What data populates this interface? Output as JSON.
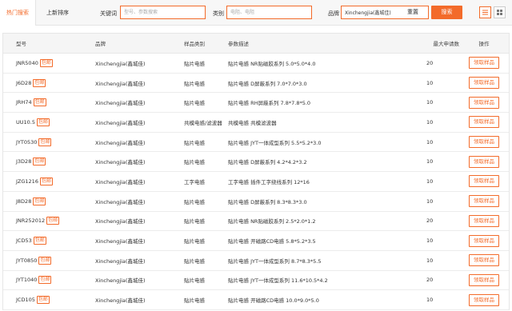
{
  "tabs": [
    {
      "label": "热门搜索",
      "active": true
    },
    {
      "label": "上新排序",
      "active": false
    }
  ],
  "filters": {
    "keyword_label": "关键词",
    "keyword_placeholder": "型号、参数搜索",
    "category_label": "类别",
    "category_placeholder": "电阻、电阻",
    "brand_label": "品牌",
    "brand_value": "Xinchengjia(鑫城佳)",
    "reset_label": "重置",
    "search_label": "搜索"
  },
  "view_icons": [
    "list-icon",
    "grid-icon"
  ],
  "table": {
    "headers": {
      "model": "型号",
      "brand": "品牌",
      "category": "样品类别",
      "description": "参数描述",
      "min_qty": "最大申请数",
      "operation": "操作"
    },
    "badge_label": "包邮",
    "button_label": "领取样品",
    "rows": [
      {
        "model": "JNR5040",
        "brand": "Xinchengjia(鑫城佳)",
        "category": "贴片电感",
        "description": "贴片电感 NR贴磁胶系列 5.0*5.0*4.0",
        "qty": "20"
      },
      {
        "model": "J6D28",
        "brand": "Xinchengjia(鑫城佳)",
        "category": "贴片电感",
        "description": "贴片电感 D屏蔽系列 7.0*7.0*3.0",
        "qty": "10"
      },
      {
        "model": "JRH74",
        "brand": "Xinchengjia(鑫城佳)",
        "category": "贴片电感",
        "description": "贴片电感 RH屏蔽系列 7.8*7.8*5.0",
        "qty": "10"
      },
      {
        "model": "UU10.5",
        "brand": "Xinchengjia(鑫城佳)",
        "category": "共模电感/滤波器",
        "description": "共模电感 共模滤波器",
        "qty": "10"
      },
      {
        "model": "JYT0530",
        "brand": "Xinchengjia(鑫城佳)",
        "category": "贴片电感",
        "description": "贴片电感 JYT一体成型系列 5.5*5.2*3.0",
        "qty": "10"
      },
      {
        "model": "J3D28",
        "brand": "Xinchengjia(鑫城佳)",
        "category": "贴片电感",
        "description": "贴片电感 D屏蔽系列 4.2*4.2*3.2",
        "qty": "10"
      },
      {
        "model": "JZG1216",
        "brand": "Xinchengjia(鑫城佳)",
        "category": "工字电感",
        "description": "工字电感 插件工字绕线系列 12*16",
        "qty": "10"
      },
      {
        "model": "J8D28",
        "brand": "Xinchengjia(鑫城佳)",
        "category": "贴片电感",
        "description": "贴片电感 D屏蔽系列 8.3*8.3*3.0",
        "qty": "10"
      },
      {
        "model": "JNR252012",
        "brand": "Xinchengjia(鑫城佳)",
        "category": "贴片电感",
        "description": "贴片电感 NR贴磁胶系列 2.5*2.0*1.2",
        "qty": "20"
      },
      {
        "model": "JCD53",
        "brand": "Xinchengjia(鑫城佳)",
        "category": "贴片电感",
        "description": "贴片电感 开磁路CD电感 5.8*5.2*3.5",
        "qty": "10"
      },
      {
        "model": "JYT0850",
        "brand": "Xinchengjia(鑫城佳)",
        "category": "贴片电感",
        "description": "贴片电感 JYT一体成型系列 8.7*8.3*5.5",
        "qty": "10"
      },
      {
        "model": "JYT1040",
        "brand": "Xinchengjia(鑫城佳)",
        "category": "贴片电感",
        "description": "贴片电感 JYT一体成型系列 11.6*10.5*4.2",
        "qty": "20"
      },
      {
        "model": "JCD105",
        "brand": "Xinchengjia(鑫城佳)",
        "category": "贴片电感",
        "description": "贴片电感 开磁路CD电感 10.0*9.0*5.0",
        "qty": "10"
      }
    ]
  },
  "accent_color": "#f36b2a"
}
